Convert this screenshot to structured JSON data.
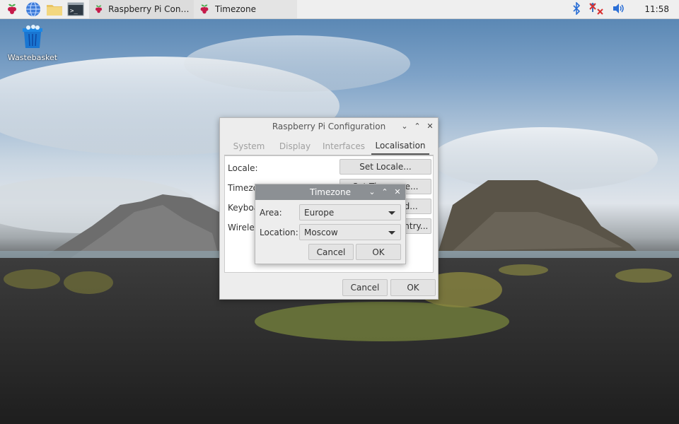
{
  "taskbar": {
    "tasks": [
      {
        "label": "Raspberry Pi Configu..."
      },
      {
        "label": "Timezone"
      }
    ],
    "clock": "11:58"
  },
  "desktop": {
    "wastebasket_label": "Wastebasket"
  },
  "config_window": {
    "title": "Raspberry Pi Configuration",
    "tabs": [
      {
        "label": "System"
      },
      {
        "label": "Display"
      },
      {
        "label": "Interfaces"
      },
      {
        "label": "Localisation"
      }
    ],
    "active_tab": "Localisation",
    "rows": [
      {
        "label": "Locale:",
        "button": "Set Locale..."
      },
      {
        "label": "Timezone:",
        "button": "Set Timezone..."
      },
      {
        "label": "Keyboard:",
        "button": "Set Keyboard..."
      },
      {
        "label": "Wireless LAN Country:",
        "button": "Set WLAN Country..."
      }
    ],
    "cancel_label": "Cancel",
    "ok_label": "OK"
  },
  "timezone_dialog": {
    "title": "Timezone",
    "area_label": "Area:",
    "area_value": "Europe",
    "location_label": "Location:",
    "location_value": "Moscow",
    "cancel_label": "Cancel",
    "ok_label": "OK"
  },
  "colors": {
    "taskbar_bg": "#efefef",
    "dialog_title_bg": "#8c9094",
    "bluetooth": "#2b6fd6",
    "network_error": "#d93030",
    "raspberry": "#c51a4a"
  }
}
